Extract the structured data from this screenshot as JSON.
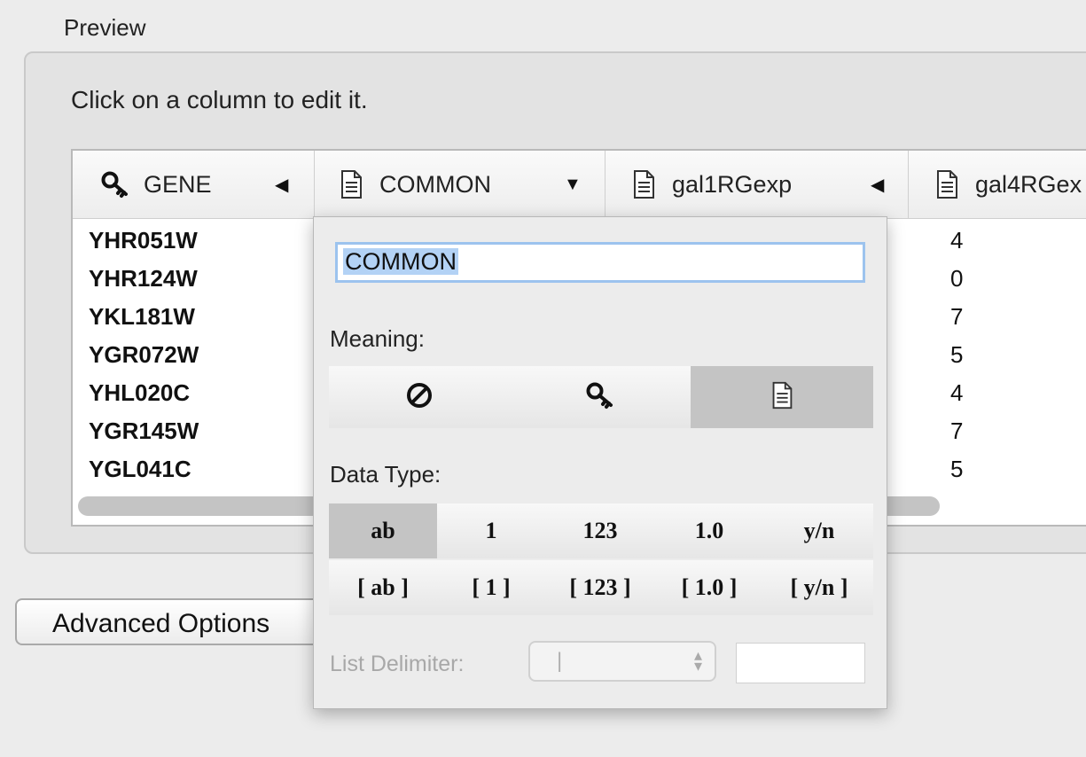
{
  "preview": {
    "title": "Preview",
    "instructions": "Click on a column to edit it."
  },
  "table": {
    "columns": [
      {
        "label": "GENE",
        "icon": "key-icon",
        "arrow": "◀"
      },
      {
        "label": "COMMON",
        "icon": "document-icon",
        "arrow": "▼"
      },
      {
        "label": "gal1RGexp",
        "icon": "document-icon",
        "arrow": "◀"
      },
      {
        "label": "gal4RGex",
        "icon": "document-icon",
        "arrow": ""
      }
    ],
    "rows": [
      "YHR051W",
      "YHR124W",
      "YKL181W",
      "YGR072W",
      "YHL020C",
      "YGR145W",
      "YGL041C"
    ],
    "partial_digits": [
      "4",
      "0",
      "7",
      "5",
      "4",
      "7",
      "5"
    ]
  },
  "advanced_button": "Advanced Options",
  "editor": {
    "column_name": "COMMON",
    "meaning_label": "Meaning:",
    "meaning_options": [
      {
        "name": "none",
        "icon": "prohibited-icon"
      },
      {
        "name": "key",
        "icon": "key-icon"
      },
      {
        "name": "attribute",
        "icon": "document-icon",
        "selected": true
      }
    ],
    "data_type_label": "Data Type:",
    "data_types": [
      "ab",
      "1",
      "123",
      "1.0",
      "y/n"
    ],
    "list_types": [
      "[ ab ]",
      "[ 1 ]",
      "[ 123 ]",
      "[ 1.0 ]",
      "[ y/n ]"
    ],
    "selected_data_type": "ab",
    "list_delimiter_label": "List Delimiter:",
    "list_delimiter_value": "|"
  }
}
